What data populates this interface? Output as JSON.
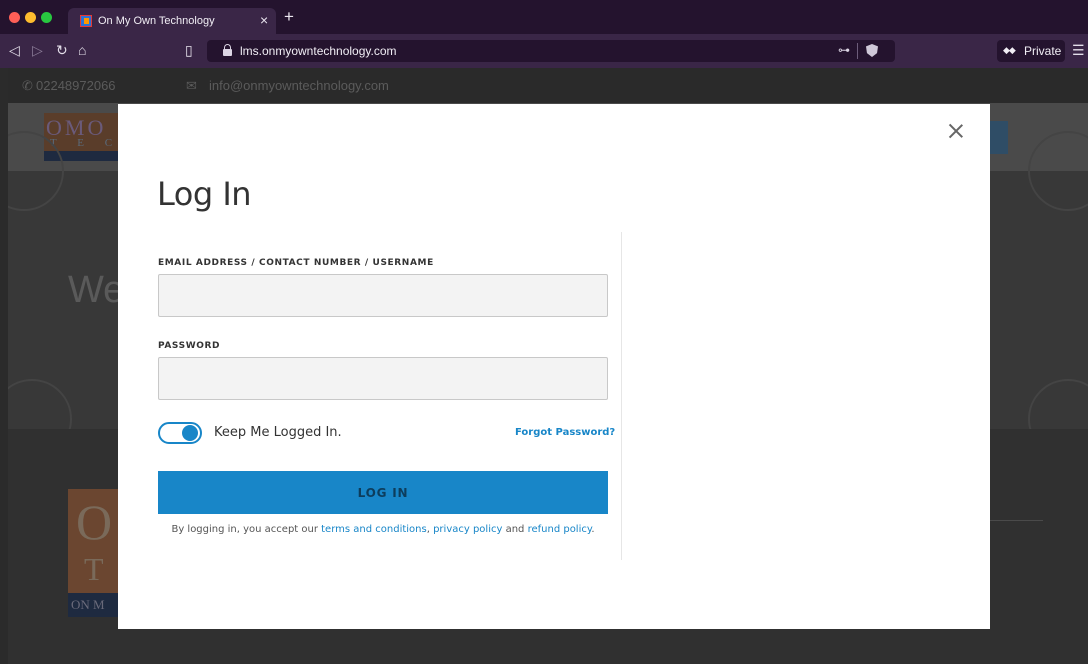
{
  "browser": {
    "tab_title": "On My Own Technology",
    "url": "lms.onmyowntechnology.com",
    "private_label": "Private",
    "icons": [
      "back-icon",
      "forward-icon",
      "reload-icon",
      "home-icon",
      "bookmark-icon",
      "lock-icon",
      "key-icon",
      "brave-shield-icon",
      "private-mask-icon",
      "menu-icon"
    ]
  },
  "background_page": {
    "phone": "02248972066",
    "email": "info@onmyowntechnology.com",
    "hero_text": "We",
    "logo_small_line1": "OMO",
    "logo_small_line2": "T E C",
    "logo_big_line1": "O",
    "logo_big_line2": "T",
    "logo_big_line3": "ON M"
  },
  "modal": {
    "title": "Log In",
    "email_label": "EMAIL ADDRESS / CONTACT NUMBER / USERNAME",
    "email_value": "",
    "password_label": "PASSWORD",
    "password_value": "",
    "keep_logged_in_label": "Keep Me Logged In.",
    "keep_logged_in_checked": true,
    "forgot_password": "Forgot Password?",
    "login_button": "LOG IN",
    "terms_prefix": "By logging in, you accept our ",
    "terms_link": "terms and conditions",
    "terms_sep": ", ",
    "privacy_link": "privacy policy",
    "terms_and": " and ",
    "refund_link": "refund policy",
    "terms_suffix": "."
  },
  "colors": {
    "accent": "#1886c8",
    "browser_dark": "#24132e",
    "browser_mid": "#3a2647",
    "modal_bg": "#ffffff"
  }
}
